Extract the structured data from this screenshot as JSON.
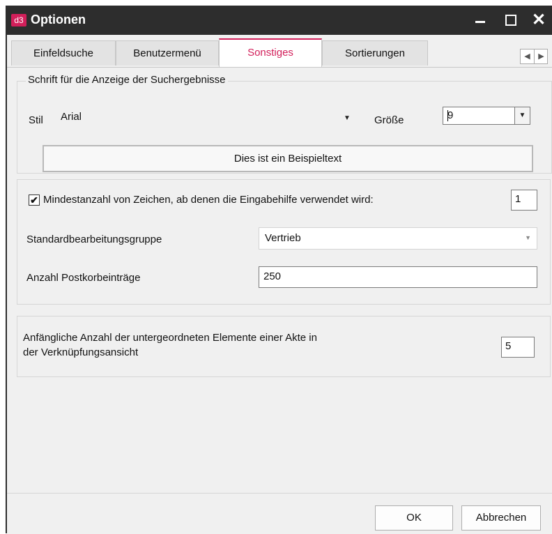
{
  "window": {
    "logo_text": "d3",
    "title": "Optionen",
    "controls": {
      "minimize": "minimize",
      "maximize": "maximize",
      "close": "✕"
    }
  },
  "tabs": [
    {
      "label": "Einfeldsuche",
      "active": false
    },
    {
      "label": "Benutzermenü",
      "active": false
    },
    {
      "label": "Sonstiges",
      "active": true
    },
    {
      "label": "Sortierungen",
      "active": false
    }
  ],
  "tab_scroll": {
    "left": "◀",
    "right": "▶"
  },
  "font_group": {
    "legend": "Schrift für die Anzeige der Suchergebnisse",
    "style_label": "Stil",
    "style_value": "Arial",
    "size_label": "Größe",
    "size_value": "9",
    "sample_text": "Dies ist ein Beispieltext"
  },
  "input_settings": {
    "min_chars_label": "Mindestanzahl von Zeichen, ab denen die Eingabehilfe verwendet wird:",
    "min_chars_checked": true,
    "min_chars_value": "1",
    "default_group_label": "Standardbearbeitungsgruppe",
    "default_group_value": "Vertrieb",
    "postbox_label": "Anzahl Postkorbeinträge",
    "postbox_value": "250"
  },
  "link_view": {
    "label_line1": "Anfängliche Anzahl der untergeordneten Elemente einer Akte in",
    "label_line2": "der Verknüpfungsansicht",
    "value": "5"
  },
  "buttons": {
    "ok": "OK",
    "cancel": "Abbrechen"
  },
  "colors": {
    "accent": "#d21f5a",
    "titlebar": "#2d2d2d",
    "dialog_bg": "#f0f0f0"
  }
}
